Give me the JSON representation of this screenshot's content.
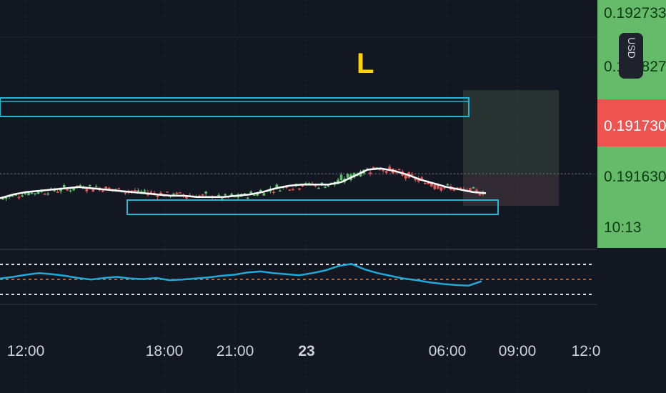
{
  "colors": {
    "background": "#131722",
    "grid": "#1f2431",
    "bull": "#5bbf6b",
    "bear": "#e5585a",
    "ema": "#ffffff",
    "zone": "#22b8d4",
    "rsi": "#22a9d9",
    "rsi_mid": "#e07b39",
    "axis_green": "#66bb6a",
    "axis_red": "#ef5350",
    "marker": "#ffd400"
  },
  "price_axis": {
    "labels": [
      "0.19273371",
      "0.19182706",
      "0.19173000",
      "0.19163000"
    ],
    "current_price": "0.19173000",
    "countdown": "10:13",
    "currency": "USD"
  },
  "time_axis": {
    "labels": [
      "12:00",
      "18:00",
      "21:00",
      "23",
      "06:00",
      "09:00",
      "12:0"
    ]
  },
  "marker": {
    "text": "L"
  },
  "chart_data": {
    "type": "candlestick",
    "price_range": [
      0.19145,
      0.19283
    ],
    "x": [
      "12:00",
      "18:00",
      "21:00",
      "23",
      "06:00",
      "09:00",
      "12:0"
    ],
    "series": [
      {
        "values": [
          0.19158,
          0.19161,
          0.19163,
          0.19164,
          0.19165,
          0.19166,
          0.19167,
          0.19166,
          0.19165,
          0.19164,
          0.19163,
          0.19162,
          0.19161,
          0.1916,
          0.1916,
          0.19159,
          0.19159,
          0.19159,
          0.1916,
          0.19161,
          0.19163,
          0.19166,
          0.19168,
          0.19169,
          0.19169,
          0.19169,
          0.19171,
          0.19176,
          0.19181,
          0.19182,
          0.1918,
          0.19177,
          0.19173,
          0.1917,
          0.19167,
          0.19165,
          0.19163,
          0.19162
        ]
      }
    ],
    "zones": [
      {
        "low": 0.19181,
        "high": 0.19185
      },
      {
        "low": 0.19153,
        "high": 0.19156
      }
    ],
    "rsi": {
      "range": [
        0,
        100
      ],
      "levels": [
        70,
        50,
        30
      ],
      "values": [
        45,
        48,
        52,
        55,
        53,
        50,
        46,
        43,
        46,
        48,
        45,
        44,
        46,
        42,
        43,
        45,
        47,
        50,
        52,
        56,
        58,
        55,
        53,
        51,
        55,
        60,
        68,
        72,
        62,
        55,
        50,
        45,
        42,
        38,
        35,
        33,
        32,
        40
      ]
    }
  }
}
